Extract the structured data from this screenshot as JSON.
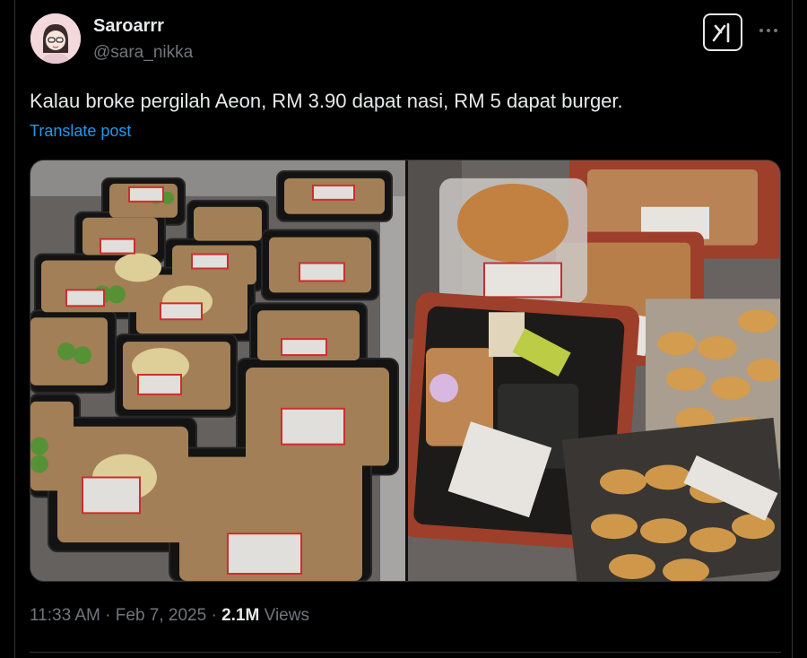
{
  "author": {
    "name": "Saroarrr",
    "handle": "@sara_nikka",
    "avatar": "avatar-illustration"
  },
  "toolbar": {
    "grok_icon": "grok-icon",
    "more_icon": "more-icon"
  },
  "post": {
    "text": "Kalau broke pergilah Aeon, RM 3.90 dapat nasi, RM 5 dapat burger.",
    "translate_label": "Translate post"
  },
  "media": {
    "photos": [
      {
        "subject": "packed rice meals in display chiller"
      },
      {
        "subject": "bento box, burger and nuggets packs"
      }
    ]
  },
  "meta": {
    "time": "11:33 AM",
    "separator": "·",
    "date": "Feb 7, 2025",
    "views_count": "2.1M",
    "views_label": "Views"
  },
  "colors": {
    "background": "#000000",
    "text": "#e7e9ea",
    "secondary": "#71767b",
    "link": "#1d9bf0",
    "border": "#2f3336"
  }
}
